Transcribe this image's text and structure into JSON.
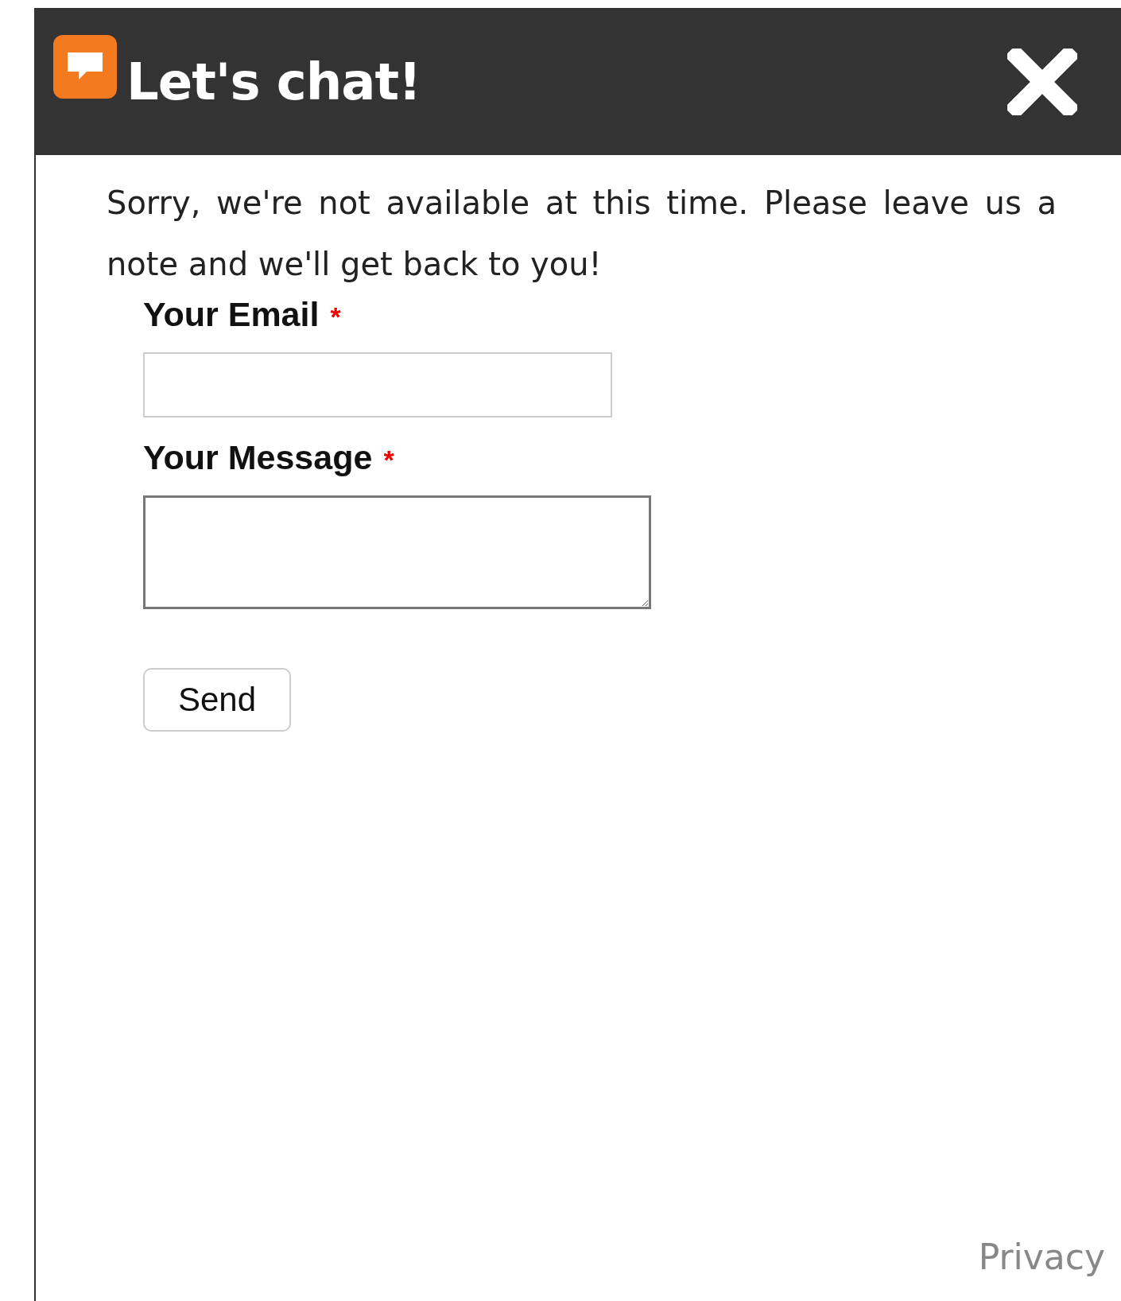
{
  "header": {
    "title": "Let's chat!"
  },
  "message": "Sorry, we're not available at this time. Please leave us a note and we'll get back to you!",
  "fields": [
    {
      "label": "Your Email",
      "marker": "*",
      "kind": "input"
    },
    {
      "label": "Your Message",
      "marker": "*",
      "kind": "textarea"
    }
  ],
  "button": "Send",
  "footer_link": "Privacy"
}
